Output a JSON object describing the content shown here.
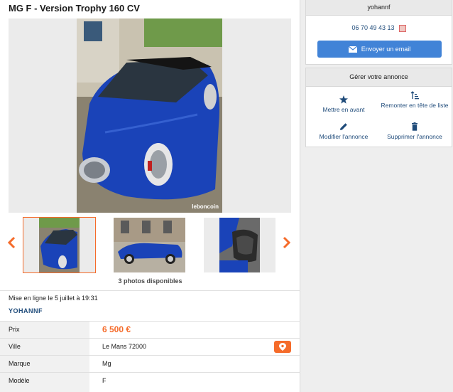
{
  "listing": {
    "title": "MG F - Version Trophy 160 CV",
    "watermark": "leboncoin",
    "photos_count": "3 photos disponibles",
    "posted": "Mise en ligne le 5 juillet à 19:31",
    "seller": "YOHANNF"
  },
  "attributes": [
    {
      "label": "Prix",
      "value": "6 500 €"
    },
    {
      "label": "Ville",
      "value": "Le Mans 72000"
    },
    {
      "label": "Marque",
      "value": "Mg"
    },
    {
      "label": "Modèle",
      "value": "F"
    }
  ],
  "contact": {
    "name": "yohannf",
    "phone": "06 70 49 43 13",
    "email_button": "Envoyer un email"
  },
  "manage": {
    "title": "Gérer votre annonce",
    "actions": [
      {
        "label": "Mettre en avant",
        "icon": "star-icon"
      },
      {
        "label": "Remonter en tête de liste",
        "icon": "sort-up-icon"
      },
      {
        "label": "Modifier l'annonce",
        "icon": "pencil-icon"
      },
      {
        "label": "Supprimer l'annonce",
        "icon": "trash-icon"
      }
    ]
  },
  "colors": {
    "accent": "#f56b2a",
    "link": "#1f4b7a",
    "button": "#4183d7"
  }
}
